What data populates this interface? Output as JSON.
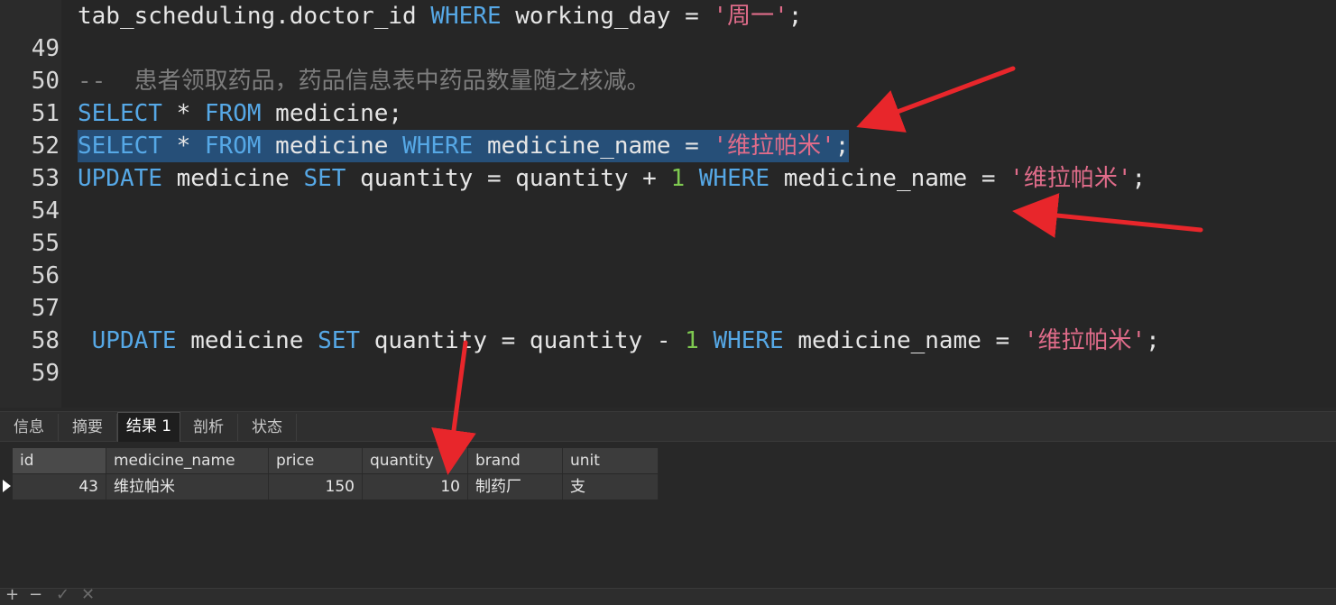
{
  "editor": {
    "lines": [
      {
        "num": "",
        "parts": [
          [
            "plain",
            "tab_scheduling.doctor_id "
          ],
          [
            "kw",
            "WHERE"
          ],
          [
            "plain",
            " working_day = "
          ],
          [
            "str",
            "'周一'"
          ],
          [
            "plain",
            ";"
          ]
        ]
      },
      {
        "num": "49",
        "parts": []
      },
      {
        "num": "50",
        "parts": [
          [
            "cmt",
            "--  患者领取药品，药品信息表中药品数量随之核减。"
          ]
        ]
      },
      {
        "num": "51",
        "parts": [
          [
            "kw",
            "SELECT"
          ],
          [
            "plain",
            " * "
          ],
          [
            "kw",
            "FROM"
          ],
          [
            "plain",
            " medicine;"
          ]
        ]
      },
      {
        "num": "52",
        "selected": true,
        "parts": [
          [
            "kw",
            "SELECT"
          ],
          [
            "plain",
            " * "
          ],
          [
            "kw",
            "FROM"
          ],
          [
            "plain",
            " medicine "
          ],
          [
            "kw",
            "WHERE"
          ],
          [
            "plain",
            " medicine_name = "
          ],
          [
            "str",
            "'维拉帕米'"
          ],
          [
            "plain",
            ";"
          ]
        ]
      },
      {
        "num": "53",
        "parts": [
          [
            "kw",
            "UPDATE"
          ],
          [
            "plain",
            " medicine "
          ],
          [
            "kw",
            "SET"
          ],
          [
            "plain",
            " quantity = quantity + "
          ],
          [
            "num",
            "1"
          ],
          [
            "plain",
            " "
          ],
          [
            "kw",
            "WHERE"
          ],
          [
            "plain",
            " medicine_name = "
          ],
          [
            "str",
            "'维拉帕米'"
          ],
          [
            "plain",
            ";"
          ]
        ]
      },
      {
        "num": "54",
        "parts": []
      },
      {
        "num": "55",
        "parts": []
      },
      {
        "num": "56",
        "parts": []
      },
      {
        "num": "57",
        "parts": []
      },
      {
        "num": "58",
        "parts": [
          [
            "plain",
            " "
          ],
          [
            "kw",
            "UPDATE"
          ],
          [
            "plain",
            " medicine "
          ],
          [
            "kw",
            "SET"
          ],
          [
            "plain",
            " quantity = quantity - "
          ],
          [
            "num",
            "1"
          ],
          [
            "plain",
            " "
          ],
          [
            "kw",
            "WHERE"
          ],
          [
            "plain",
            " medicine_name = "
          ],
          [
            "str",
            "'维拉帕米'"
          ],
          [
            "plain",
            ";"
          ]
        ]
      },
      {
        "num": "59",
        "parts": []
      }
    ]
  },
  "tabs": [
    "信息",
    "摘要",
    "结果 1",
    "剖析",
    "状态"
  ],
  "active_tab": "结果 1",
  "results": {
    "columns": [
      "id",
      "medicine_name",
      "price",
      "quantity",
      "brand",
      "unit"
    ],
    "rows": [
      [
        "43",
        "维拉帕米",
        "150",
        "10",
        "制药厂",
        "支"
      ]
    ]
  },
  "bottom_toolbar": {
    "add": "+",
    "remove": "−",
    "apply": "✓",
    "cancel": "✕"
  },
  "colors": {
    "keyword": "#56a8e6",
    "string": "#e06c8a",
    "number": "#7ec950",
    "comment": "#7d7d7d",
    "selection": "#264f78",
    "arrow": "#e8262b"
  }
}
